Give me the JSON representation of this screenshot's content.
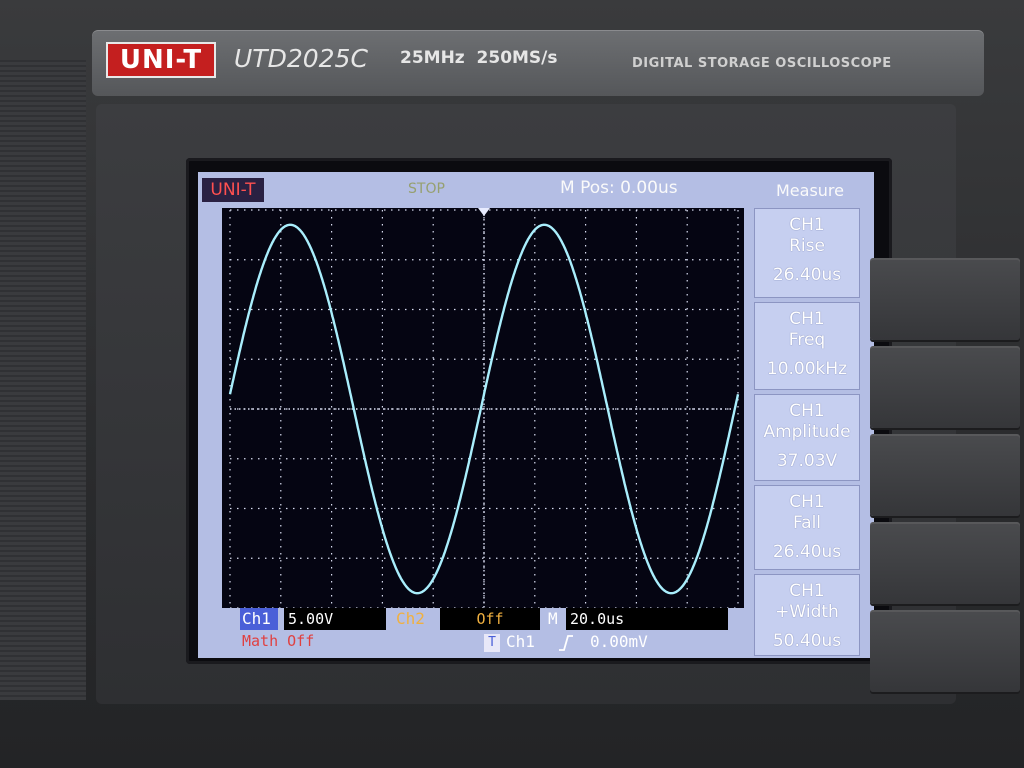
{
  "device": {
    "brand_logo": "UNI-T",
    "model": "UTD2025C",
    "spec": "25MHz  250MS/s",
    "description": "DIGITAL STORAGE OSCILLOSCOPE"
  },
  "screen": {
    "brand": "UNI-T",
    "status": "STOP",
    "m_pos": "M Pos: 0.00us",
    "menu_title": "Measure",
    "measurements": [
      {
        "ch": "CH1",
        "name": "Rise",
        "value": "26.40us"
      },
      {
        "ch": "CH1",
        "name": "Freq",
        "value": "10.00kHz"
      },
      {
        "ch": "CH1",
        "name": "Amplitude",
        "value": "37.03V"
      },
      {
        "ch": "CH1",
        "name": "Fall",
        "value": "26.40us"
      },
      {
        "ch": "CH1",
        "name": "+Width",
        "value": "50.40us"
      }
    ],
    "bottom": {
      "ch1_label": "Ch1",
      "ch1_scale": "5.00V",
      "ch2_label": "Ch2",
      "ch2_state": "Off",
      "time_label": "M",
      "time_scale": "20.0us",
      "math_label": "Math Off",
      "trigger_icon": "T",
      "trigger_source": "Ch1",
      "trigger_slope_icon": "rising-edge-icon",
      "trigger_level": "0.00mV"
    },
    "colors": {
      "trace": "#a9eefc",
      "ch1": "#ffffff",
      "ch2": "#f0b040",
      "math": "#e04040",
      "grid": "#d8dcf0"
    }
  },
  "chart_data": {
    "type": "line",
    "series": [
      {
        "name": "CH1",
        "frequency_khz": 10.0,
        "amplitude_v": 37.03,
        "volts_per_div": 5.0,
        "time_per_div_us": 20.0
      }
    ],
    "grid": true
  }
}
